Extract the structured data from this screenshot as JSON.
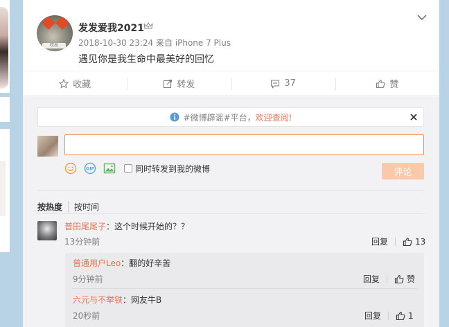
{
  "post": {
    "username": "发发爱我2021",
    "avatar_caption": "哎出",
    "timestamp": "2018-10-30 23:24",
    "source": "来自 iPhone 7 Plus",
    "text": "遇见你是我生命中最美好的回忆"
  },
  "actions": {
    "favorite": "收藏",
    "repost": "转发",
    "comment_count": "37",
    "like": "赞"
  },
  "notice": {
    "prefix": "#微博辟谣#平台，",
    "highlight": "欢迎查阅!"
  },
  "composer": {
    "input_value": "",
    "repost_label": "同时转发到我的微博",
    "submit_label": "评论"
  },
  "sort": {
    "by_heat": "按热度",
    "by_time": "按时间"
  },
  "comments": [
    {
      "name": "普田尾尾子",
      "text": "：这个时候开始的？？",
      "time": "13分钟前",
      "reply": "回复",
      "likes": "13"
    }
  ],
  "replies": [
    {
      "name": "普通用户Leo",
      "text": "：翻的好辛苦",
      "time": "9分钟前",
      "reply": "回复",
      "likes": "赞"
    },
    {
      "name": "六元与不举铁",
      "text": "：网友牛B",
      "time": "20秒前",
      "reply": "回复",
      "likes": "1"
    }
  ],
  "colors": {
    "accent": "#eb7350",
    "input_border": "#f08f4d",
    "submit_disabled": "#fbc9a9",
    "page_bg": "#b9d3e6"
  }
}
